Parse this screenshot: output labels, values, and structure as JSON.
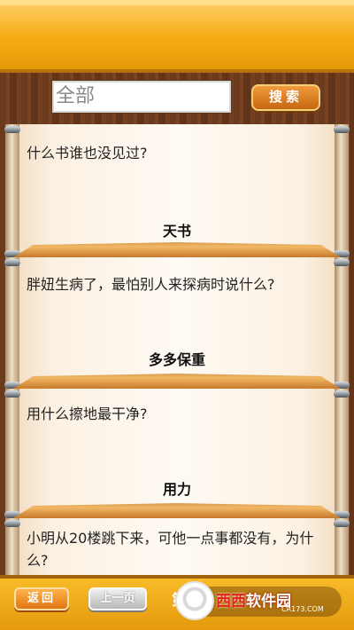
{
  "search": {
    "value": "全部",
    "button_label": "搜索"
  },
  "riddles": [
    {
      "question": "什么书谁也没见过?",
      "answer": "天书"
    },
    {
      "question": "胖妞生病了，最怕别人来探病时说什么?",
      "answer": "多多保重"
    },
    {
      "question": "用什么擦地最干净?",
      "answer": "用力"
    },
    {
      "question": "小明从20楼跳下来，可他一点事都没有，为什么?",
      "answer": ""
    }
  ],
  "footer": {
    "back_label": "返回",
    "prev_label": "上一页",
    "page_label": "第"
  },
  "watermark": {
    "brand_red": "西西",
    "brand_rest": "软件园",
    "url": "CR173.COM"
  },
  "colors": {
    "header": "#f6ab16",
    "wood": "#6c3b1d",
    "button_orange": "#e27514"
  }
}
